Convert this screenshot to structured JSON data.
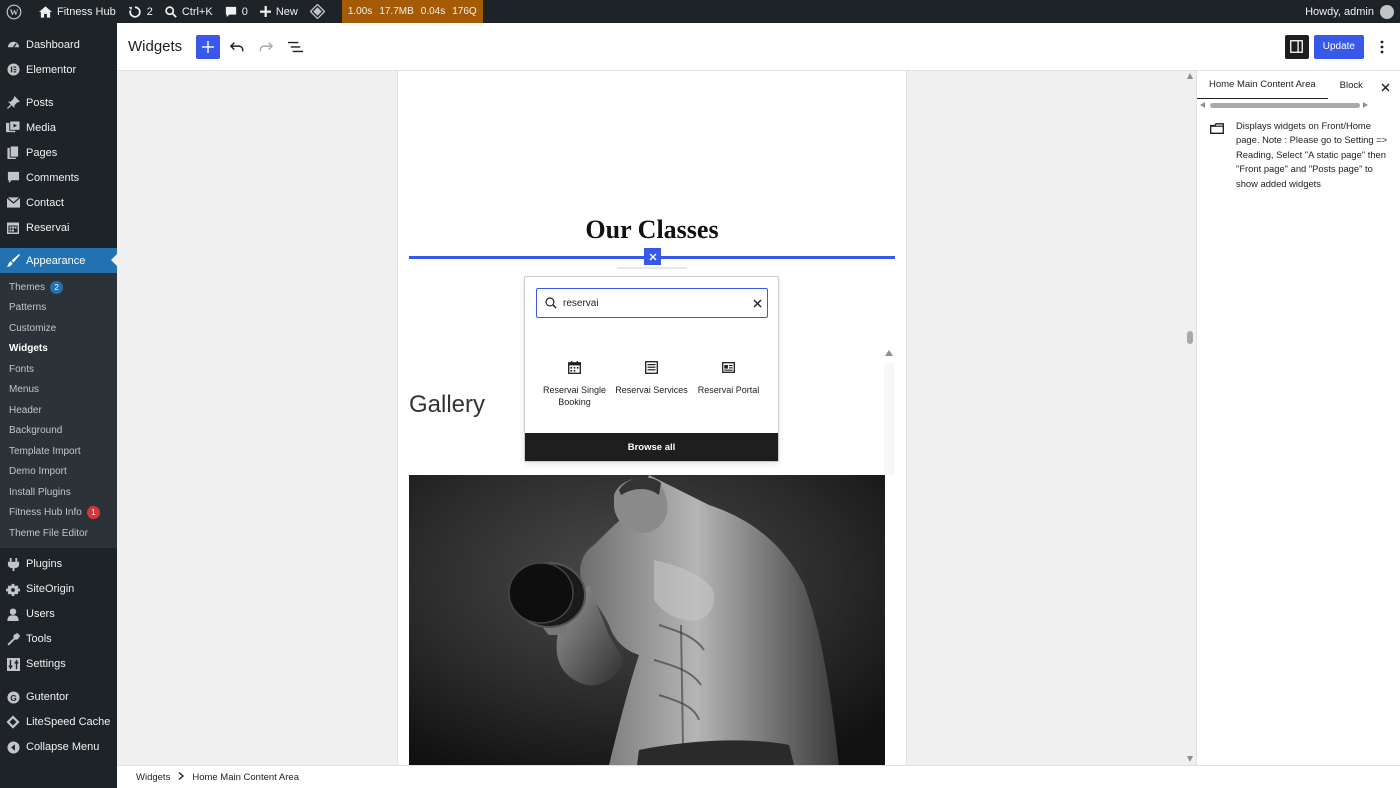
{
  "admin_bar": {
    "site_name": "Fitness Hub",
    "updates_count": "2",
    "search_shortcut": "Ctrl+K",
    "comments_count": "0",
    "new_label": "New",
    "perf": [
      "1.00s",
      "17.7MB",
      "0.04s",
      "176Q"
    ],
    "howdy": "Howdy, admin"
  },
  "sidebar": {
    "items": [
      {
        "label": "Dashboard",
        "icon": "dashboard-icon"
      },
      {
        "label": "Elementor",
        "icon": "elementor-icon"
      },
      {
        "label": "Posts",
        "icon": "pin-icon"
      },
      {
        "label": "Media",
        "icon": "media-icon"
      },
      {
        "label": "Pages",
        "icon": "pages-icon"
      },
      {
        "label": "Comments",
        "icon": "comment-icon"
      },
      {
        "label": "Contact",
        "icon": "mail-icon"
      },
      {
        "label": "Reservai",
        "icon": "calendar-icon"
      },
      {
        "label": "Appearance",
        "icon": "brush-icon"
      }
    ],
    "submenu": [
      {
        "label": "Themes",
        "badge": "2"
      },
      {
        "label": "Patterns"
      },
      {
        "label": "Customize"
      },
      {
        "label": "Widgets"
      },
      {
        "label": "Fonts"
      },
      {
        "label": "Menus"
      },
      {
        "label": "Header"
      },
      {
        "label": "Background"
      },
      {
        "label": "Template Import"
      },
      {
        "label": "Demo Import"
      },
      {
        "label": "Install Plugins"
      },
      {
        "label": "Fitness Hub Info",
        "badge": "1"
      },
      {
        "label": "Theme File Editor"
      }
    ],
    "items_after": [
      {
        "label": "Plugins",
        "icon": "plug-icon"
      },
      {
        "label": "SiteOrigin",
        "icon": "siteorigin-icon"
      },
      {
        "label": "Users",
        "icon": "user-icon"
      },
      {
        "label": "Tools",
        "icon": "wrench-icon"
      },
      {
        "label": "Settings",
        "icon": "settings-icon"
      }
    ],
    "items_bottom": [
      {
        "label": "Gutentor",
        "icon": "gutentor-icon"
      },
      {
        "label": "LiteSpeed Cache",
        "icon": "litespeed-icon"
      },
      {
        "label": "Collapse Menu",
        "icon": "collapse-icon"
      }
    ]
  },
  "editor": {
    "title": "Widgets",
    "update_label": "Update"
  },
  "canvas": {
    "classes_heading": "Our Classes",
    "gallery_heading": "Gallery"
  },
  "inserter": {
    "search_value": "reservai",
    "results": [
      {
        "label": "Reservai Single Booking",
        "icon": "calendar-icon"
      },
      {
        "label": "Reservai Services",
        "icon": "list-icon"
      },
      {
        "label": "Reservai Portal",
        "icon": "id-card-icon"
      }
    ],
    "browse_all": "Browse all"
  },
  "right_panel": {
    "tabs": [
      "Home Main Content Area",
      "Block"
    ],
    "description": "Displays widgets on Front/Home page. Note : Please go to Setting => Reading, Select \"A static page\" then \"Front page\" and \"Posts page\" to show added widgets"
  },
  "footer": {
    "crumb_root": "Widgets",
    "crumb_current": "Home Main Content Area"
  },
  "colors": {
    "accent": "#3858e9",
    "wp_admin_dark": "#1d2327",
    "wp_admin_blue": "#2271b1",
    "perf_bar": "#a55b06"
  }
}
